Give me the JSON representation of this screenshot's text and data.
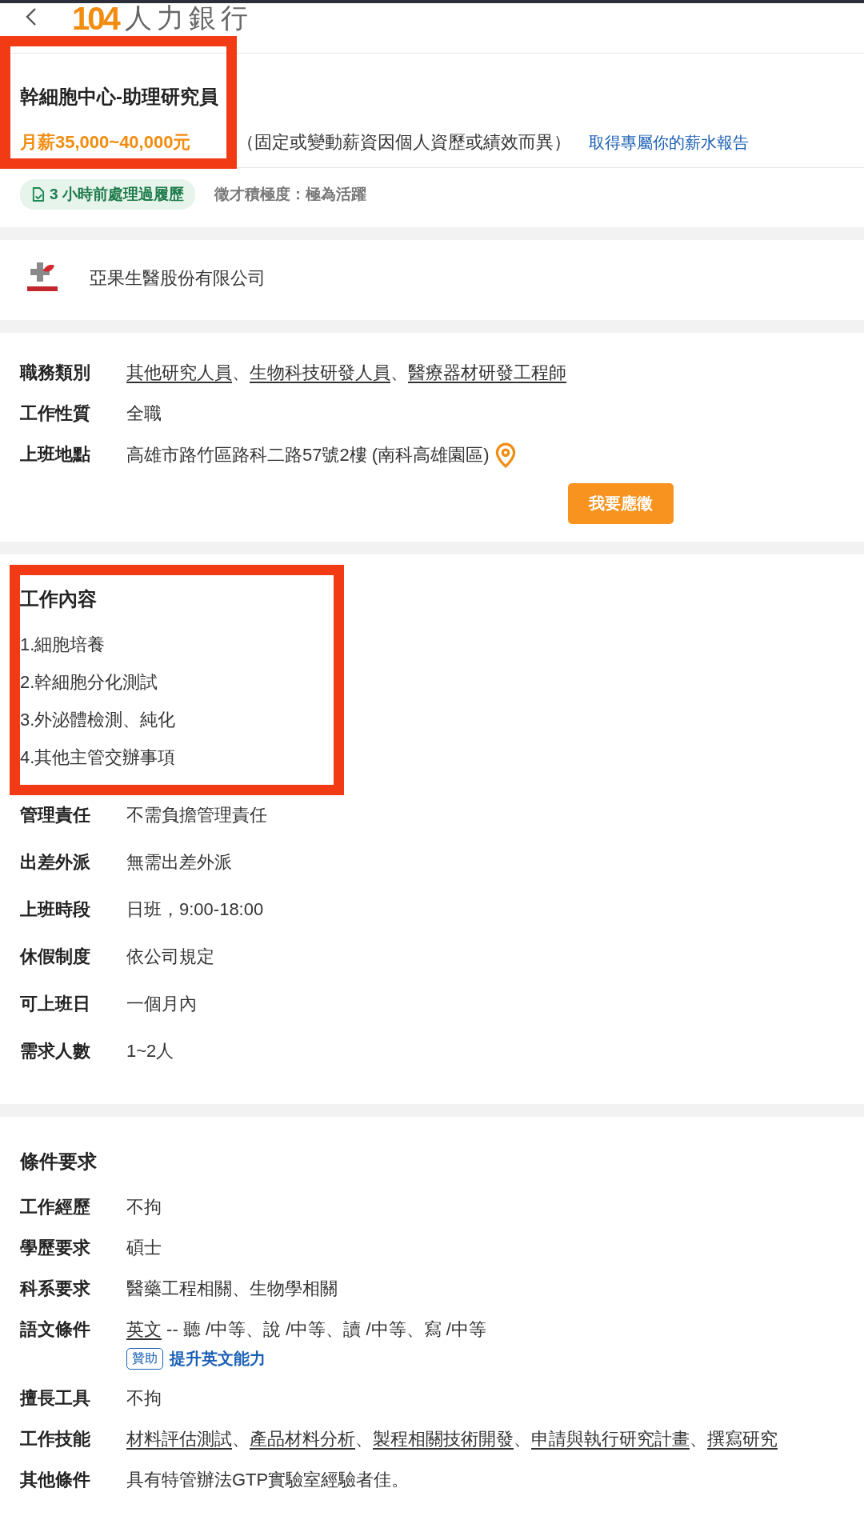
{
  "header": {
    "logo_number": "104",
    "logo_text": "人力銀行"
  },
  "job": {
    "title": "幹細胞中心-助理研究員",
    "salary": "月薪35,000~40,000元",
    "salary_note": "（固定或變動薪資因個人資歷或績效而異）",
    "salary_link": "取得專屬你的薪水報告",
    "highlighted": true,
    "badge": "3 小時前處理過履歷",
    "activity": "徵才積極度：極為活躍"
  },
  "company": {
    "name": "亞果生醫股份有限公司"
  },
  "details": [
    {
      "label": "職務類別",
      "kind": "links",
      "separator": "、",
      "links": [
        "其他研究人員",
        "生物科技研發人員",
        "醫療器材研發工程師"
      ]
    },
    {
      "label": "工作性質",
      "kind": "text",
      "value": "全職"
    },
    {
      "label": "上班地點",
      "kind": "location",
      "value": "高雄市路竹區路科二路57號2樓 (南科高雄園區)"
    }
  ],
  "apply_button": "我要應徵",
  "job_content": {
    "heading": "工作內容",
    "highlighted": true,
    "items": [
      "1.細胞培養",
      "2.幹細胞分化測試",
      "3.外泌體檢測、純化",
      "4.其他主管交辦事項"
    ]
  },
  "job_details": [
    {
      "label": "管理責任",
      "kind": "text",
      "value": "不需負擔管理責任"
    },
    {
      "label": "出差外派",
      "kind": "text",
      "value": "無需出差外派"
    },
    {
      "label": "上班時段",
      "kind": "text",
      "value": "日班，9:00-18:00"
    },
    {
      "label": "休假制度",
      "kind": "text",
      "value": "依公司規定"
    },
    {
      "label": "可上班日",
      "kind": "text",
      "value": "一個月內"
    },
    {
      "label": "需求人數",
      "kind": "text",
      "value": "1~2人"
    }
  ],
  "conditions": {
    "heading": "條件要求",
    "rows": [
      {
        "label": "工作經歷",
        "kind": "text",
        "value": "不拘"
      },
      {
        "label": "學歷要求",
        "kind": "text",
        "value": "碩士"
      },
      {
        "label": "科系要求",
        "kind": "text",
        "value": "醫藥工程相關、生物學相關"
      },
      {
        "label": "語文條件",
        "kind": "language",
        "link": "英文",
        "value": "-- 聽 /中等、說 /中等、讀 /中等、寫 /中等",
        "tag": "贊助",
        "tag_link": "提升英文能力"
      },
      {
        "label": "擅長工具",
        "kind": "text",
        "value": "不拘"
      },
      {
        "label": "工作技能",
        "kind": "links",
        "separator": "、",
        "links": [
          "材料評估測試",
          "產品材料分析",
          "製程相關技術開發",
          "申請與執行研究計畫",
          "撰寫研究"
        ]
      },
      {
        "label": "其他條件",
        "kind": "text",
        "value": "具有特管辦法GTP實驗室經驗者佳。"
      }
    ]
  }
}
